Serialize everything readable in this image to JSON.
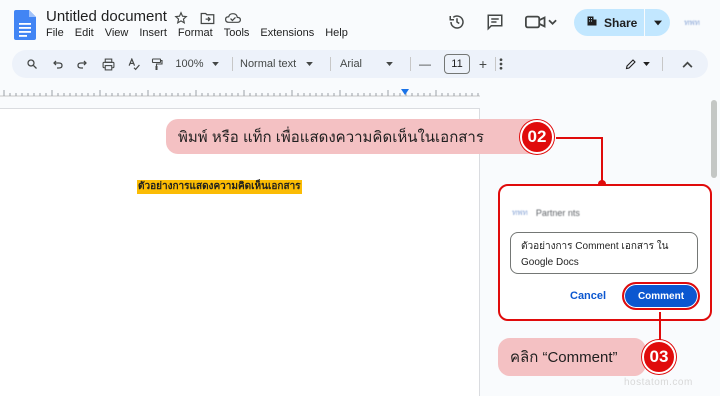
{
  "header": {
    "title": "Untitled document",
    "menu": [
      "File",
      "Edit",
      "View",
      "Insert",
      "Format",
      "Tools",
      "Extensions",
      "Help"
    ],
    "share_label": "Share",
    "avatar_text": "ทพท"
  },
  "toolbar": {
    "zoom": "100%",
    "style": "Normal text",
    "font": "Arial",
    "font_size": "11",
    "minus": "—",
    "plus": "+"
  },
  "document": {
    "highlighted_text": "ตัวอย่างการแสดงความคิดเห็นเอกสาร"
  },
  "comment_card": {
    "user_name": "Partner nts",
    "user_avatar": "ทพท",
    "input_value": "ตัวอย่างการ Comment เอกสาร ใน Google Docs",
    "cancel_label": "Cancel",
    "comment_label": "Comment"
  },
  "callouts": {
    "step_02_text": "พิมพ์ หรือ แท็ก เพื่อแสดงความคิดเห็นในเอกสาร",
    "step_02_number": "02",
    "step_03_text": "คลิก “Comment”",
    "step_03_number": "03"
  },
  "watermark": "hostatom.com",
  "colors": {
    "accent": "#0b57d0",
    "share_bg": "#c2e7ff",
    "highlight": "#fbbc04",
    "callout_bg": "#f4c1c3",
    "annotation_red": "#e00b0b"
  }
}
